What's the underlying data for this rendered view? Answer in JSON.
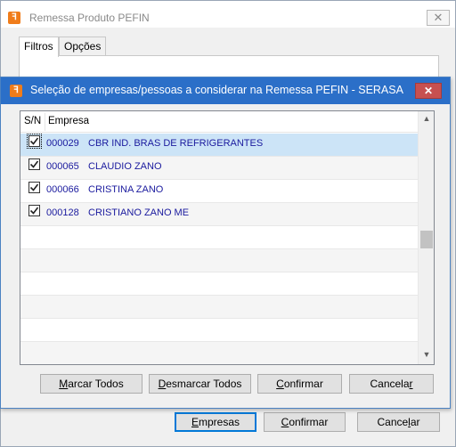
{
  "back_window": {
    "title": "Remessa Produto PEFIN",
    "close_glyph": "✕",
    "tabs": [
      {
        "label": "Filtros"
      },
      {
        "label": "Opções"
      }
    ],
    "buttons": {
      "empresas": {
        "mnemonic": "E",
        "rest": "mpresas"
      },
      "confirmar": {
        "mnemonic": "C",
        "rest": "onfirmar"
      },
      "cancelar": {
        "pre": "Cance",
        "mnemonic": "l",
        "rest": "ar"
      }
    }
  },
  "dialog": {
    "title": "Seleção de empresas/pessoas a considerar na Remessa PEFIN - SERASA",
    "close_glyph": "✕",
    "columns": {
      "sn": "S/N",
      "empresa": "Empresa"
    },
    "rows": [
      {
        "checked": true,
        "code": "000029",
        "name": "CBR IND. BRAS DE REFRIGERANTES",
        "selected": true
      },
      {
        "checked": true,
        "code": "000065",
        "name": "CLAUDIO ZANO",
        "selected": false
      },
      {
        "checked": true,
        "code": "000066",
        "name": "CRISTINA ZANO",
        "selected": false
      },
      {
        "checked": true,
        "code": "000128",
        "name": "CRISTIANO ZANO ME",
        "selected": false
      }
    ],
    "empty_rows": 6,
    "scroll": {
      "up": "▲",
      "down": "▼"
    },
    "buttons": {
      "marcar_todos": {
        "mnemonic": "M",
        "rest": "arcar Todos"
      },
      "desmarcar_todos": {
        "mnemonic": "D",
        "rest": "esmarcar Todos"
      },
      "confirmar": {
        "mnemonic": "C",
        "rest": "onfirmar"
      },
      "cancelar": {
        "pre": "Cancela",
        "mnemonic": "r",
        "rest": ""
      }
    }
  },
  "colors": {
    "dialog_titlebar": "#2b6fc8",
    "selected_row": "#cce4f7",
    "row_text": "#1a1a9e",
    "app_icon": "#f07c1a"
  }
}
